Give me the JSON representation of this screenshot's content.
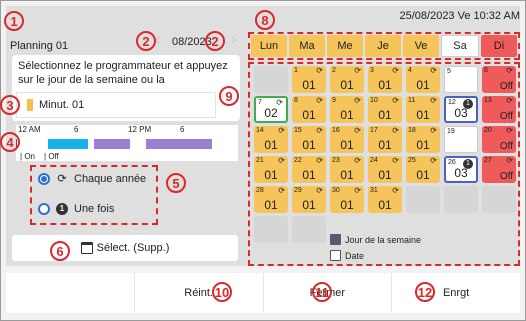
{
  "datetime": "25/08/2023 Ve 10:32 AM",
  "header": {
    "title": "Planning 01",
    "month": "08/2023"
  },
  "instructions": "Sélectionnez le programmateur et appuyez sur le jour de la semaine ou la",
  "program": {
    "label": "Minut. 01",
    "color": "#f0c050"
  },
  "timeline": {
    "labels": [
      "12 AM",
      "6",
      "12 PM",
      "6"
    ],
    "legend_on": "On",
    "legend_off": "Off",
    "colors": {
      "on": "#19b0ee",
      "off": "#9a7fd2"
    }
  },
  "repeat_options": [
    {
      "label": "Chaque année",
      "icon": "cycle-icon",
      "selected": true
    },
    {
      "label": "Une fois",
      "icon": "once-icon",
      "selected": false
    }
  ],
  "select_delete_label": "Sélect. (Supp.)",
  "weekdays": [
    {
      "label": "Lun",
      "bg": "#f5c45a"
    },
    {
      "label": "Ma",
      "bg": "#f5c45a"
    },
    {
      "label": "Me",
      "bg": "#f5c45a"
    },
    {
      "label": "Je",
      "bg": "#f5c45a"
    },
    {
      "label": "Ve",
      "bg": "#f5c45a"
    },
    {
      "label": "Sa",
      "bg": "#ffffff"
    },
    {
      "label": "Di",
      "bg": "#ef5a5a"
    }
  ],
  "calendar": [
    {
      "n": "",
      "v": "",
      "type": "empty"
    },
    {
      "n": "1",
      "v": "01",
      "type": "prog",
      "cyc": true
    },
    {
      "n": "2",
      "v": "01",
      "type": "prog",
      "cyc": true
    },
    {
      "n": "3",
      "v": "01",
      "type": "prog",
      "cyc": true
    },
    {
      "n": "4",
      "v": "01",
      "type": "prog",
      "cyc": true
    },
    {
      "n": "5",
      "v": "",
      "type": "white"
    },
    {
      "n": "6",
      "v": "Off",
      "type": "off",
      "cyc": true
    },
    {
      "n": "7",
      "v": "02",
      "type": "white-green",
      "cyc": true
    },
    {
      "n": "8",
      "v": "01",
      "type": "prog",
      "cyc": true
    },
    {
      "n": "9",
      "v": "01",
      "type": "prog",
      "cyc": true
    },
    {
      "n": "10",
      "v": "01",
      "type": "prog",
      "cyc": true
    },
    {
      "n": "11",
      "v": "01",
      "type": "prog",
      "cyc": true
    },
    {
      "n": "12",
      "v": "03",
      "type": "white-blue",
      "once": true
    },
    {
      "n": "13",
      "v": "Off",
      "type": "off",
      "cyc": true
    },
    {
      "n": "14",
      "v": "01",
      "type": "prog",
      "cyc": true
    },
    {
      "n": "15",
      "v": "01",
      "type": "prog",
      "cyc": true
    },
    {
      "n": "16",
      "v": "01",
      "type": "prog",
      "cyc": true
    },
    {
      "n": "17",
      "v": "01",
      "type": "prog",
      "cyc": true
    },
    {
      "n": "18",
      "v": "01",
      "type": "prog",
      "cyc": true
    },
    {
      "n": "19",
      "v": "",
      "type": "white"
    },
    {
      "n": "20",
      "v": "Off",
      "type": "off",
      "cyc": true
    },
    {
      "n": "21",
      "v": "01",
      "type": "prog",
      "cyc": true
    },
    {
      "n": "22",
      "v": "01",
      "type": "prog",
      "cyc": true
    },
    {
      "n": "23",
      "v": "01",
      "type": "prog",
      "cyc": true
    },
    {
      "n": "24",
      "v": "01",
      "type": "prog",
      "cyc": true
    },
    {
      "n": "25",
      "v": "01",
      "type": "prog",
      "cyc": true
    },
    {
      "n": "26",
      "v": "03",
      "type": "white-blue",
      "once": true
    },
    {
      "n": "27",
      "v": "Off",
      "type": "off",
      "cyc": true
    },
    {
      "n": "28",
      "v": "01",
      "type": "prog",
      "cyc": true
    },
    {
      "n": "29",
      "v": "01",
      "type": "prog",
      "cyc": true
    },
    {
      "n": "30",
      "v": "01",
      "type": "prog",
      "cyc": true
    },
    {
      "n": "31",
      "v": "01",
      "type": "prog",
      "cyc": true
    },
    {
      "n": "",
      "v": "",
      "type": "empty"
    },
    {
      "n": "",
      "v": "",
      "type": "empty"
    },
    {
      "n": "",
      "v": "",
      "type": "empty"
    },
    {
      "n": "",
      "v": "",
      "type": "empty"
    },
    {
      "n": "",
      "v": "",
      "type": "empty"
    }
  ],
  "legend": {
    "weekday_label": "Jour de la semaine",
    "date_label": "Date"
  },
  "bottom": {
    "reset": "Réint.",
    "close": "Fermer",
    "save": "Enrgt"
  },
  "callouts": [
    "1",
    "2",
    "2",
    "3",
    "4",
    "5",
    "6",
    "8",
    "9",
    "10",
    "11",
    "12"
  ]
}
